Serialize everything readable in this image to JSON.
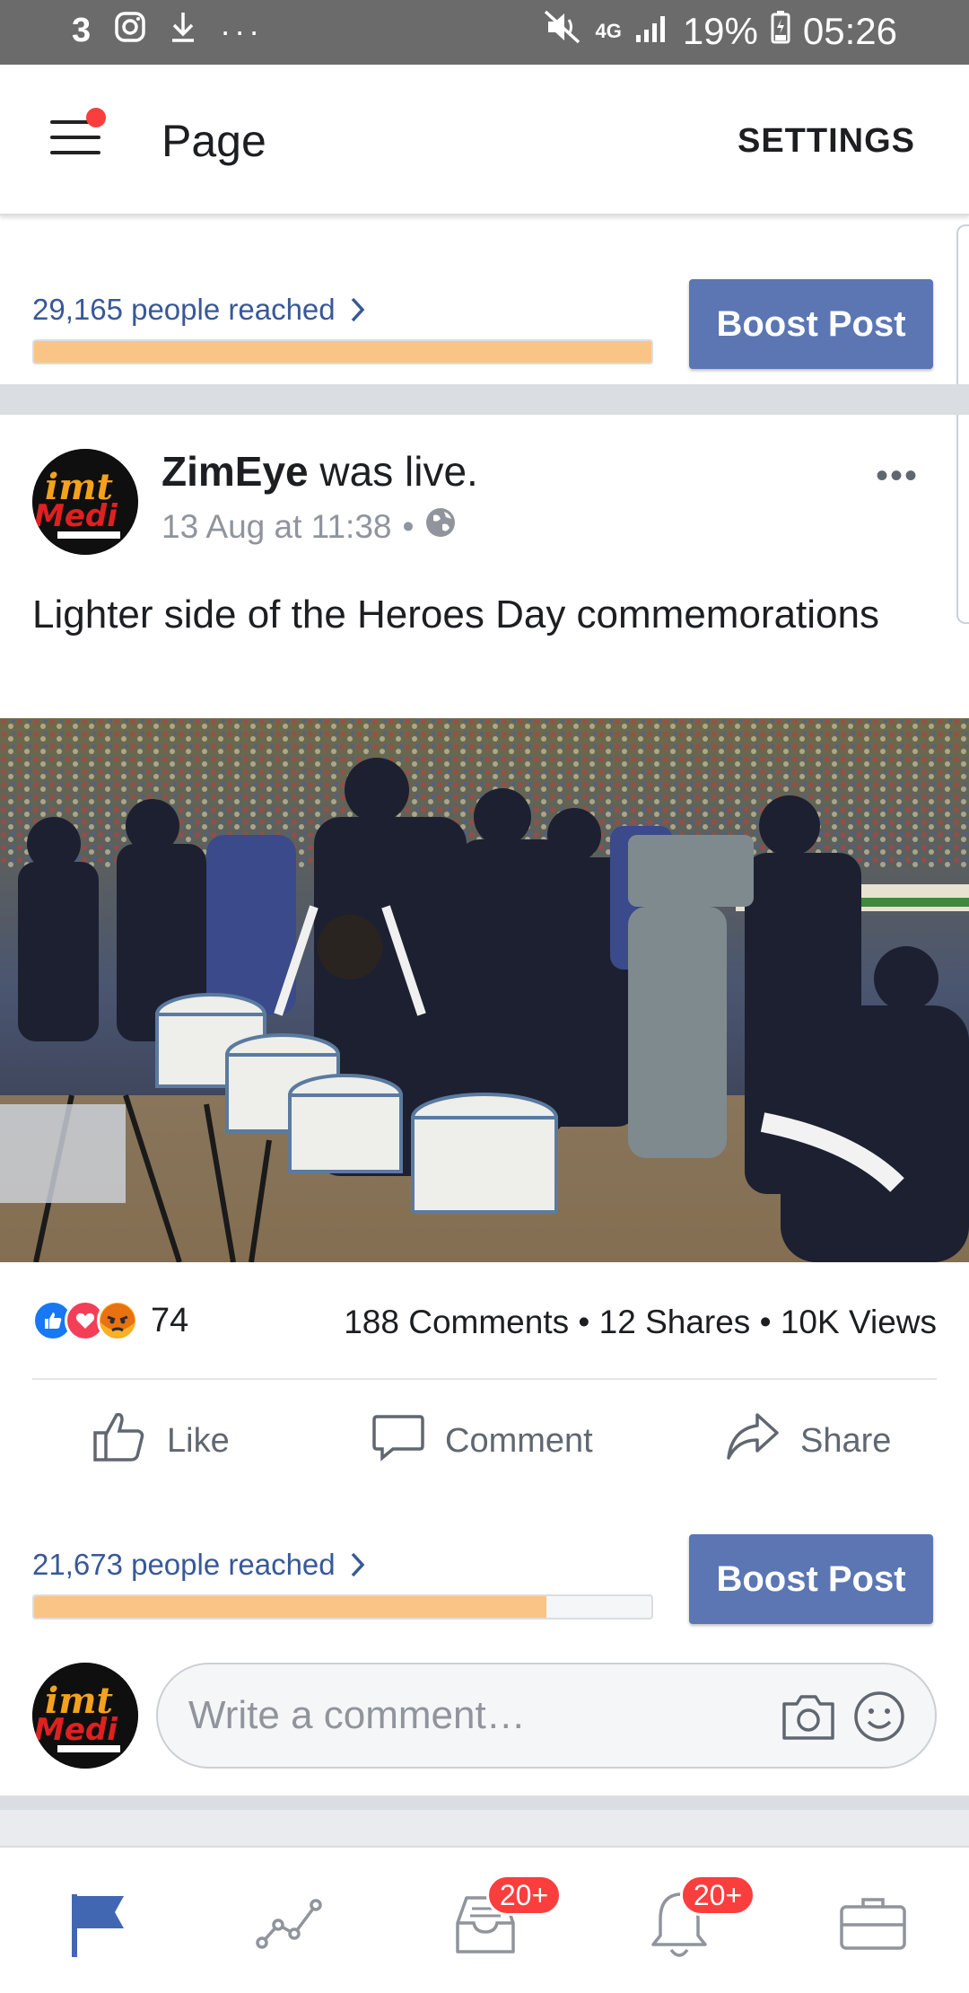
{
  "status_bar": {
    "battery": "19%",
    "time": "05:26",
    "network": "4G"
  },
  "header": {
    "title": "Page",
    "settings_label": "SETTINGS"
  },
  "top_reach": {
    "text": "29,165 people reached",
    "progress_fraction": 1.0,
    "boost_label": "Boost Post"
  },
  "post": {
    "author": "ZimEye",
    "action": " was live.",
    "timestamp": "13 Aug at 11:38",
    "separator": "•",
    "text": "Lighter side of the Heroes Day commemorations",
    "reactions_count": "74",
    "comments": "188 Comments",
    "shares": "12 Shares",
    "views": "10K Views",
    "actions": {
      "like": "Like",
      "comment": "Comment",
      "share": "Share"
    },
    "reach_text": "21,673 people reached",
    "reach_fraction": 0.83,
    "boost_label": "Boost Post",
    "comment_placeholder": "Write a comment…"
  },
  "tabbar": {
    "badges": [
      "20+",
      "20+"
    ]
  },
  "colors": {
    "link_blue": "#385898",
    "boost_blue": "#5b76b3",
    "progress_orange": "#fbc487",
    "badge_red": "#fa3e3e",
    "active_tab": "#4267b2"
  }
}
